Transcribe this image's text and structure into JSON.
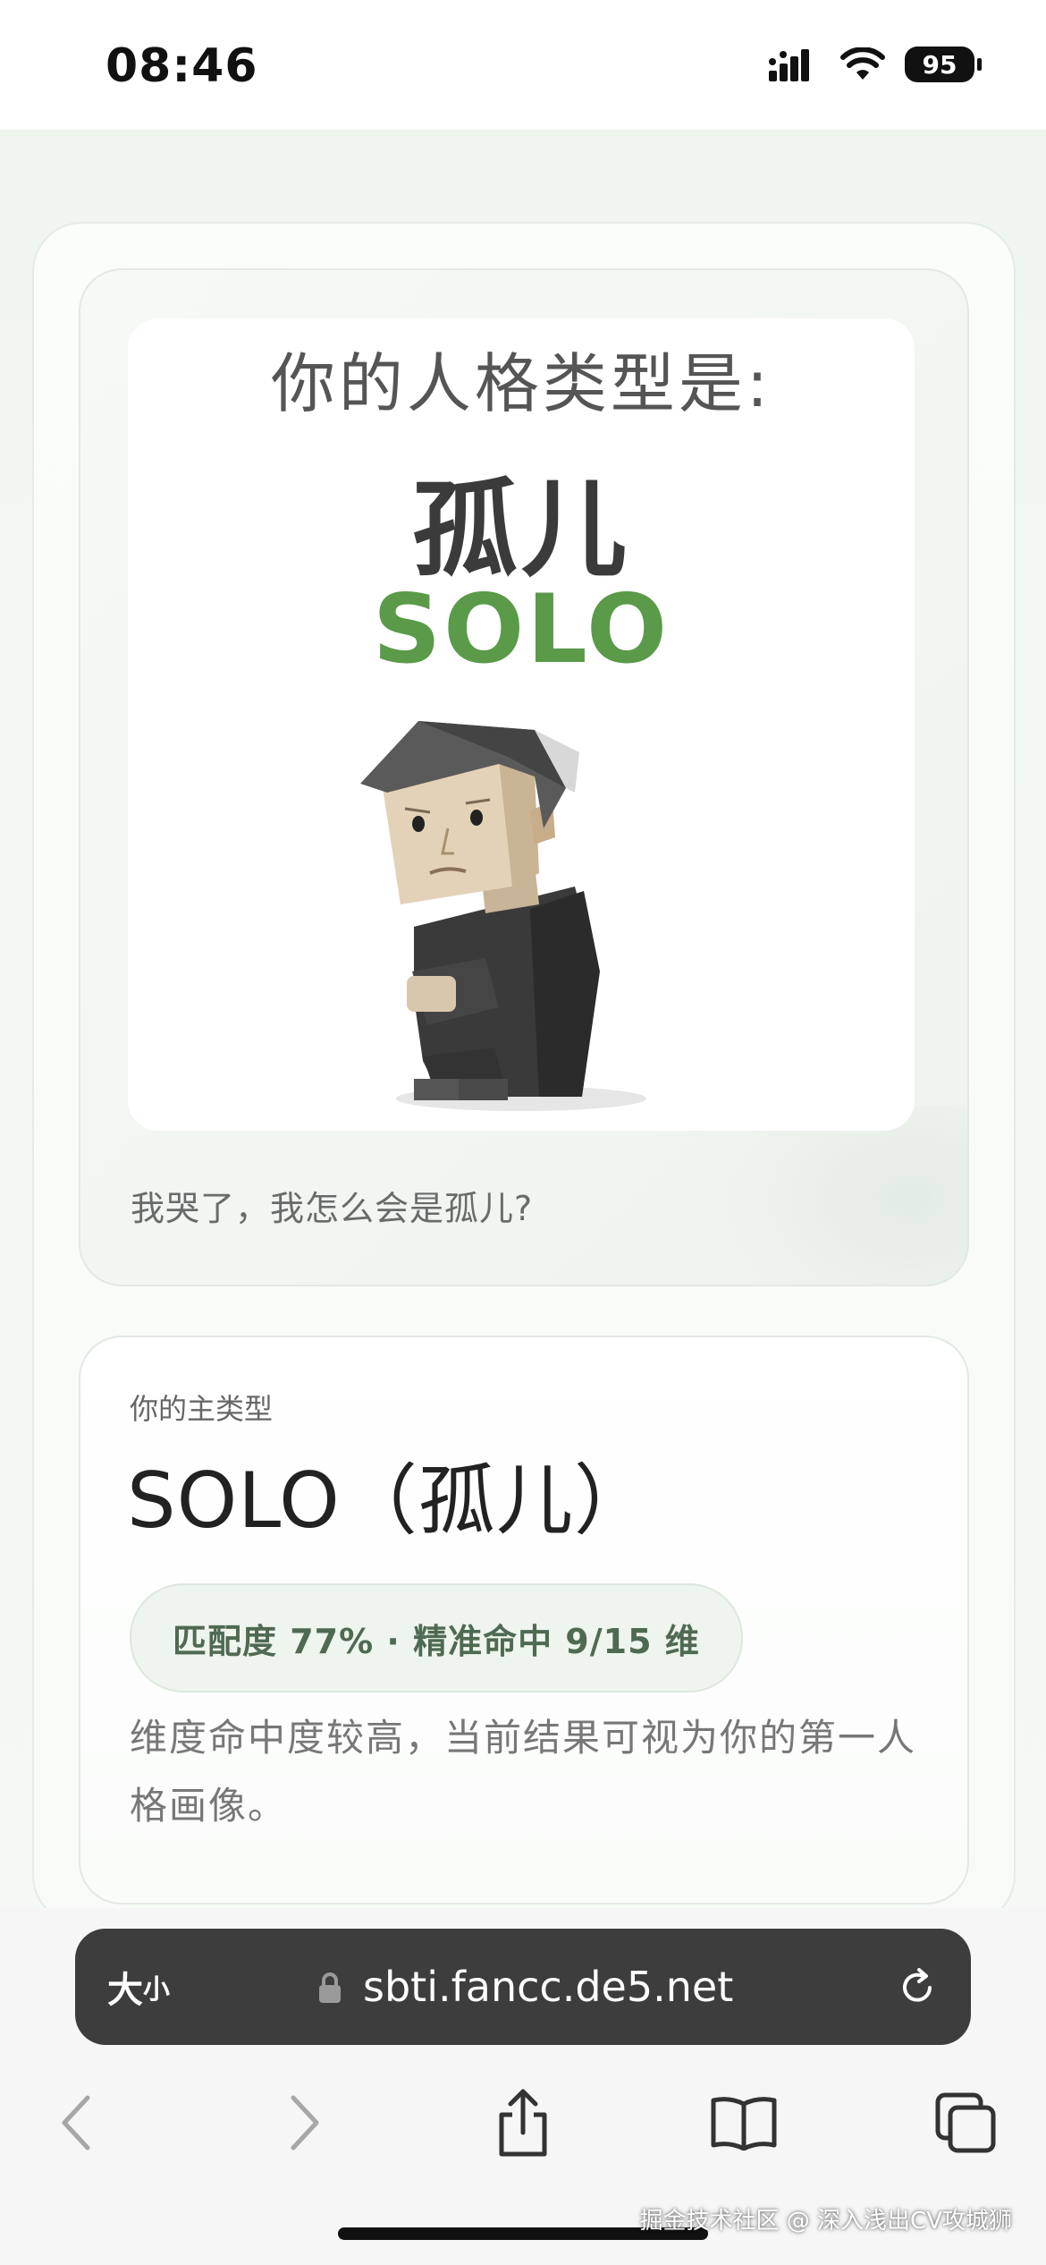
{
  "status_bar": {
    "time": "08:46",
    "battery": "95"
  },
  "poster": {
    "heading": "你的人格类型是:",
    "type_cn": "孤儿",
    "type_en": "SOLO",
    "caption": "我哭了，我怎么会是孤儿?"
  },
  "result": {
    "label": "你的主类型",
    "title": "SOLO（孤儿）",
    "match": "匹配度 77% · 精准命中 9/15 维",
    "description": "维度命中度较高，当前结果可视为你的第一人格画像。"
  },
  "browser": {
    "text_size_big": "大",
    "text_size_small": "小",
    "url": "sbti.fancc.de5.net"
  },
  "watermark": "掘金技术社区 @ 深入浅出CV攻城狮"
}
